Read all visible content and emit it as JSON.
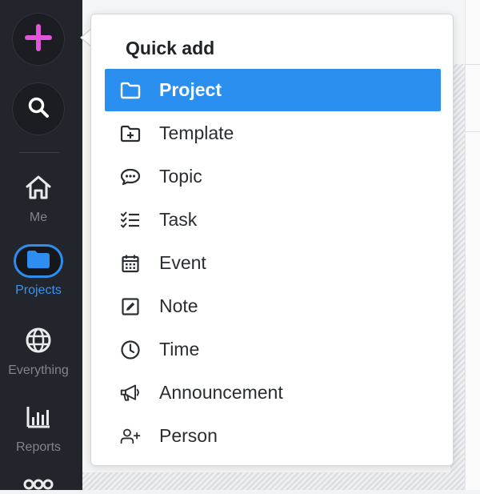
{
  "sidebar": {
    "items": [
      {
        "label": "Me",
        "icon": "home-icon"
      },
      {
        "label": "Projects",
        "icon": "folder-icon",
        "active": true
      },
      {
        "label": "Everything",
        "icon": "globe-icon"
      },
      {
        "label": "Reports",
        "icon": "bar-chart-icon"
      }
    ],
    "add_icon": "plus-icon",
    "search_icon": "search-icon",
    "colors": {
      "accent": "#2e8ef0",
      "plus": "#e056d8",
      "bg": "#22252b"
    }
  },
  "quick_add": {
    "title": "Quick add",
    "items": [
      {
        "label": "Project",
        "icon": "folder-icon",
        "selected": true
      },
      {
        "label": "Template",
        "icon": "folder-plus-icon"
      },
      {
        "label": "Topic",
        "icon": "chat-bubble-icon"
      },
      {
        "label": "Task",
        "icon": "checklist-icon"
      },
      {
        "label": "Event",
        "icon": "calendar-icon"
      },
      {
        "label": "Note",
        "icon": "edit-note-icon"
      },
      {
        "label": "Time",
        "icon": "clock-icon"
      },
      {
        "label": "Announcement",
        "icon": "megaphone-icon"
      },
      {
        "label": "Person",
        "icon": "add-person-icon"
      }
    ]
  }
}
